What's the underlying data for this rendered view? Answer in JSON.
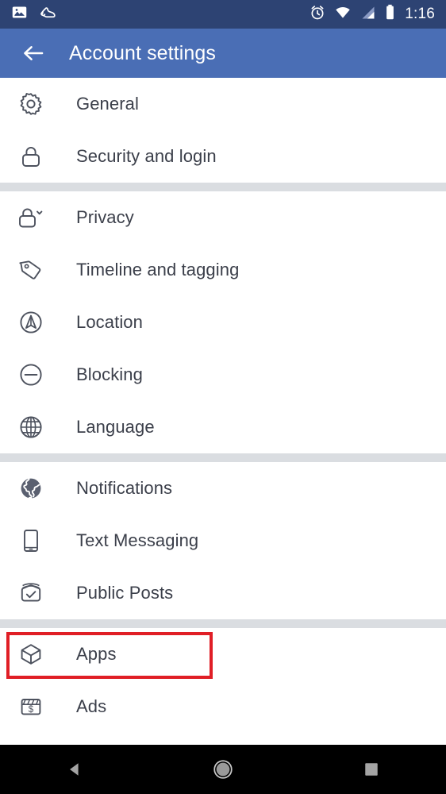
{
  "status_bar": {
    "background": "#2d4373",
    "left_icons": [
      {
        "name": "photo-icon",
        "label": "Screenshot saved"
      },
      {
        "name": "shoe-icon",
        "label": "Fitness tracker"
      }
    ],
    "right_icons": [
      {
        "name": "alarm-icon",
        "label": "Alarm set"
      },
      {
        "name": "wifi-icon",
        "label": "Wi-Fi connected"
      },
      {
        "name": "cellular-signal-icon",
        "label": "Cellular signal"
      },
      {
        "name": "battery-icon",
        "label": "Battery"
      }
    ],
    "time": "1:16"
  },
  "app_bar": {
    "background": "#4a6eb5",
    "back_label": "Back",
    "title": "Account settings"
  },
  "highlight": {
    "color": "#e01e26",
    "target": "Apps"
  },
  "sections": [
    {
      "id": "section-account",
      "rows": [
        {
          "id": "general",
          "icon": "gear-icon",
          "label": "General"
        },
        {
          "id": "security-and-login",
          "icon": "lock-icon",
          "label": "Security and login"
        }
      ]
    },
    {
      "id": "section-privacy",
      "rows": [
        {
          "id": "privacy",
          "icon": "lock-chevron-icon",
          "label": "Privacy"
        },
        {
          "id": "timeline-and-tagging",
          "icon": "tag-icon",
          "label": "Timeline and tagging"
        },
        {
          "id": "location",
          "icon": "location-arrow-icon",
          "label": "Location"
        },
        {
          "id": "blocking",
          "icon": "minus-circle-icon",
          "label": "Blocking"
        },
        {
          "id": "language",
          "icon": "globe-outline-icon",
          "label": "Language"
        }
      ]
    },
    {
      "id": "section-notifications",
      "rows": [
        {
          "id": "notifications",
          "icon": "globe-filled-icon",
          "label": "Notifications"
        },
        {
          "id": "text-messaging",
          "icon": "phone-icon",
          "label": "Text Messaging"
        },
        {
          "id": "public-posts",
          "icon": "box-check-icon",
          "label": "Public Posts"
        }
      ]
    },
    {
      "id": "section-apps",
      "rows": [
        {
          "id": "apps",
          "icon": "cube-icon",
          "label": "Apps",
          "highlighted": true
        },
        {
          "id": "ads",
          "icon": "dollar-board-icon",
          "label": "Ads"
        }
      ]
    }
  ],
  "nav_bar": {
    "background": "#000000",
    "buttons": [
      {
        "id": "back",
        "icon": "triangle-back-icon",
        "label": "Back"
      },
      {
        "id": "home",
        "icon": "circle-home-icon",
        "label": "Home"
      },
      {
        "id": "recents",
        "icon": "square-recents-icon",
        "label": "Recent apps"
      }
    ]
  }
}
